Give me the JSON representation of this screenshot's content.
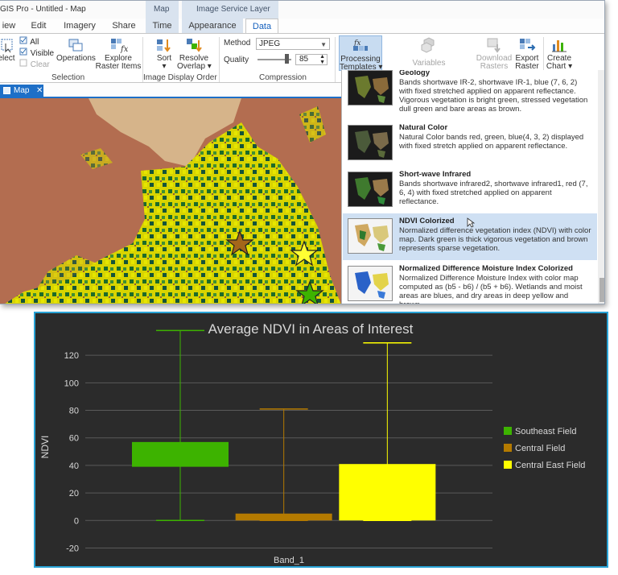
{
  "app": {
    "title": "GIS Pro - Untitled - Map",
    "context_groups": [
      "Map",
      "Image Service Layer"
    ],
    "tabs": [
      "iew",
      "Edit",
      "Imagery",
      "Share",
      "Time",
      "Appearance",
      "Data"
    ],
    "active_tab": "Data"
  },
  "ribbon": {
    "select_label": "elect",
    "all_label": "All",
    "visible_label": "Visible",
    "clear_label": "Clear",
    "operations_label": "Operations",
    "explore_line1": "Explore",
    "explore_line2": "Raster Items",
    "selection_group": "Selection",
    "sort_label": "Sort",
    "resolve_line1": "Resolve",
    "resolve_line2": "Overlap",
    "image_display_group": "Image Display Order",
    "method_label": "Method",
    "method_value": "JPEG",
    "quality_label": "Quality",
    "quality_value": "85",
    "quality_level": 0.85,
    "compression_group": "Compression",
    "processing_line1": "Processing",
    "processing_line2": "Templates",
    "variables_label": "Variables",
    "download_line1": "Download",
    "download_line2": "Rasters",
    "export_line1": "Export",
    "export_line2": "Raster",
    "create_line1": "Create",
    "create_line2": "Chart"
  },
  "map_view": {
    "tab_label": "Map",
    "close_glyph": "✕"
  },
  "gallery": {
    "items": [
      {
        "title": "Geology",
        "desc": "Bands shortwave IR-2, shortwave IR-1, blue (7, 6, 2) with fixed stretched applied on apparent reflectance. Vigorous vegetation is bright green, stressed vegetation dull green and bare areas as brown."
      },
      {
        "title": "Natural Color",
        "desc": "Natural Color bands red, green, blue(4, 3, 2) displayed with fixed stretch applied on apparent reflectance."
      },
      {
        "title": "Short-wave Infrared",
        "desc": "Bands shortwave infrared2, shortwave infrared1, red (7, 6, 4) with fixed stretched applied on apparent reflectance."
      },
      {
        "title": "NDVI Colorized",
        "desc": "Normalized difference vegetation index (NDVI) with color map. Dark green is thick vigorous vegetation and brown represents sparse vegetation."
      },
      {
        "title": "Normalized Difference Moisture Index Colorized",
        "desc": "Normalized Difference Moisture Index with color map computed as (b5 - b6) / (b5 + b6). Wetlands and moist areas are blues, and dry areas in deep yellow and brown."
      }
    ],
    "hover_index": 3
  },
  "chart_data": {
    "type": "box",
    "title": "Average NDVI in Areas of Interest",
    "xlabel": "Band_1",
    "ylabel": "NDVI",
    "ylim": [
      -25,
      140
    ],
    "yticks": [
      -20,
      0,
      20,
      40,
      60,
      80,
      100,
      120
    ],
    "grid": true,
    "legend_position": "right",
    "categories": [
      "Band_1"
    ],
    "series": [
      {
        "name": "Southeast Field",
        "color": "#3db300",
        "min": 0,
        "q1": 39,
        "q3": 57,
        "max": 138
      },
      {
        "name": "Central Field",
        "color": "#b47a00",
        "min": 0,
        "q1": 0,
        "q3": 5,
        "max": 81
      },
      {
        "name": "Central East Field",
        "color": "#ffff00",
        "min": 0,
        "q1": 0,
        "q3": 41,
        "max": 129
      }
    ]
  }
}
